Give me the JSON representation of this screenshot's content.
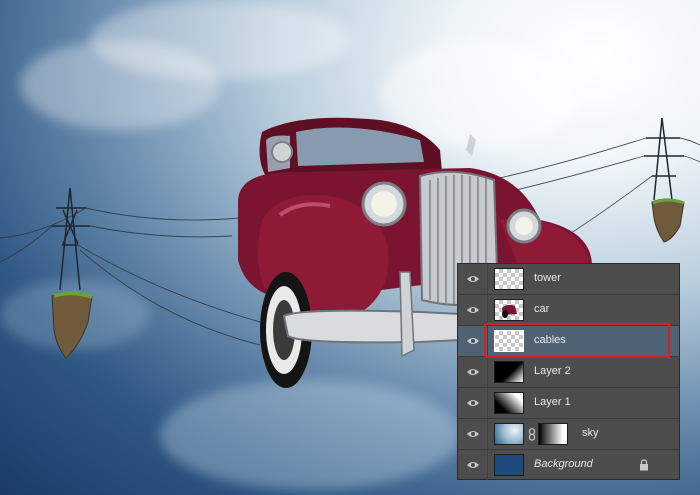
{
  "layers": [
    {
      "name": "tower",
      "selected": false,
      "visible": true
    },
    {
      "name": "car",
      "selected": false,
      "visible": true
    },
    {
      "name": "cables",
      "selected": true,
      "visible": true
    },
    {
      "name": "Layer 2",
      "selected": false,
      "visible": true
    },
    {
      "name": "Layer 1",
      "selected": false,
      "visible": true
    },
    {
      "name": "sky",
      "selected": false,
      "visible": true
    },
    {
      "name": "Background",
      "selected": false,
      "visible": true,
      "locked": true
    }
  ],
  "colors": {
    "panel_bg": "#4d4d4d",
    "selected_row": "#4f6273",
    "highlight_outline": "#d8211f",
    "background_swatch": "#1e4a80"
  }
}
